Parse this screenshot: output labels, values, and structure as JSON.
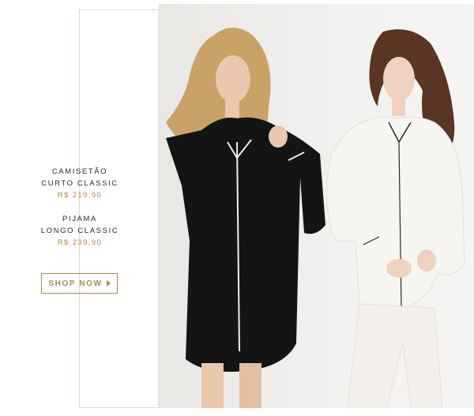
{
  "products": [
    {
      "name_line1": "CAMISETÃO",
      "name_line2": "CURTO CLASSIC",
      "price": "R$ 219,90"
    },
    {
      "name_line1": "PIJAMA",
      "name_line2": "LONGO CLASSIC",
      "price": "R$ 239,90"
    }
  ],
  "cta": {
    "label": "SHOP NOW"
  },
  "colors": {
    "accent": "#b08a45",
    "frame": "#e3d9c6",
    "text": "#2a2a2a"
  }
}
